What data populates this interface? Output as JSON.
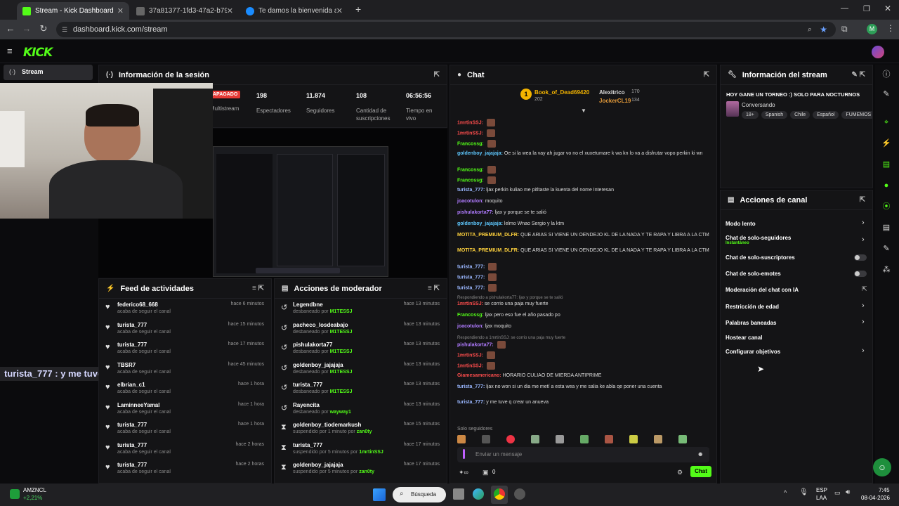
{
  "browser": {
    "tabs": [
      {
        "title": "Stream - Kick Dashboard"
      },
      {
        "title": "37a81377-1fd3-47a2-b79e-557"
      },
      {
        "title": "Te damos la bienvenida a Prime"
      }
    ],
    "url": "dashboard.kick.com/stream",
    "profile_initial": "M"
  },
  "sidebar": {
    "stream_label": "Stream"
  },
  "session": {
    "title": "Información de la sesión",
    "status_badge": "APAGADO",
    "multistream_label": "Multistream",
    "stats": [
      {
        "value": "198",
        "label": "Espectadores"
      },
      {
        "value": "11.874",
        "label": "Seguidores"
      },
      {
        "value": "108",
        "label": "Cantidad de suscripciones"
      },
      {
        "value": "06:56:56",
        "label": "Tiempo en vivo"
      }
    ]
  },
  "overlay_caption": "turista_777 : y me tuve q crear un anueva",
  "activity": {
    "title": "Feed de actividades",
    "rows": [
      {
        "name": "federico68_668",
        "time": "hace 6 minutos",
        "sub": "acaba de seguir el canal"
      },
      {
        "name": "turista_777",
        "time": "hace 15 minutos",
        "sub": "acaba de seguir el canal"
      },
      {
        "name": "turista_777",
        "time": "hace 17 minutos",
        "sub": "acaba de seguir el canal"
      },
      {
        "name": "TBSR7",
        "time": "hace 45 minutos",
        "sub": "acaba de seguir el canal"
      },
      {
        "name": "elbrian_c1",
        "time": "hace 1 hora",
        "sub": "acaba de seguir el canal"
      },
      {
        "name": "LaminneeYamal",
        "time": "hace 1 hora",
        "sub": "acaba de seguir el canal"
      },
      {
        "name": "turista_777",
        "time": "hace 1 hora",
        "sub": "acaba de seguir el canal"
      },
      {
        "name": "turista_777",
        "time": "hace 2 horas",
        "sub": "acaba de seguir el canal"
      },
      {
        "name": "turista_777",
        "time": "hace 2 horas",
        "sub": "acaba de seguir el canal"
      }
    ]
  },
  "moderator": {
    "title": "Acciones de moderador",
    "rows": [
      {
        "name": "Legendbne",
        "time": "hace 13 minutos",
        "sub": "desbaneado por",
        "by": "M1TESSJ"
      },
      {
        "name": "pacheco_losdeabajo",
        "time": "hace 13 minutos",
        "sub": "desbaneado por",
        "by": "M1TESSJ"
      },
      {
        "name": "pishulakorta77",
        "time": "hace 13 minutos",
        "sub": "desbaneado por",
        "by": "M1TESSJ"
      },
      {
        "name": "goldenboy_jajajaja",
        "time": "hace 13 minutos",
        "sub": "desbaneado por",
        "by": "M1TESSJ"
      },
      {
        "name": "turista_777",
        "time": "hace 13 minutos",
        "sub": "desbaneado por",
        "by": "M1TESSJ"
      },
      {
        "name": "Rayencita",
        "time": "hace 13 minutos",
        "sub": "desbaneado por",
        "by": "wayway1"
      },
      {
        "name": "goldenboy_tiodemarkush",
        "time": "hace 15 minutos",
        "sub": "suspendido por 1 minuto por",
        "by": "zan0ty"
      },
      {
        "name": "turista_777",
        "time": "hace 17 minutos",
        "sub": "suspendido por 5 minutos por",
        "by": "1mrtinSSJ"
      },
      {
        "name": "goldenboy_jajajaja",
        "time": "hace 17 minutos",
        "sub": "suspendido por 5 minutos por",
        "by": "zan0ty"
      }
    ]
  },
  "chat": {
    "title": "Chat",
    "top": [
      {
        "rank": "1",
        "name": "Book_of_Dead69420",
        "count": "202"
      },
      {
        "name": "Alexitrico",
        "count": "170"
      },
      {
        "name": "JockerCL19",
        "count": "134"
      }
    ],
    "lines": [
      {
        "user": "1mrtinSSJ:",
        "color": "#ff4d4d",
        "text": ""
      },
      {
        "user": "1mrtinSSJ:",
        "color": "#ff4d4d",
        "text": ""
      },
      {
        "user": "Francossg:",
        "color": "#53fc18",
        "text": ""
      },
      {
        "user": "goldenboy_jajajaja:",
        "color": "#5ec8ff",
        "text": "Oe si la wea la vay ah jugar vo no el xuxetumare k wa kn lo va a disfrutar vopo perkin ki wn"
      },
      {
        "user": "Francossg:",
        "color": "#53fc18",
        "text": ""
      },
      {
        "user": "Francossg:",
        "color": "#53fc18",
        "text": ""
      },
      {
        "user": "turista_777:",
        "color": "#9ab7ff",
        "text": "ljax perkin kuliao me pitltaste la kuenta del nome Interesan"
      },
      {
        "user": "joacotulon:",
        "color": "#b07bff",
        "text": "moquito"
      },
      {
        "user": "pishulakorta77:",
        "color": "#b07bff",
        "text": "ljax y porque se te salió"
      },
      {
        "user": "goldenboy_jajajaja:",
        "color": "#5ec8ff",
        "text": "lelmo Wnao Sergio y la ktm"
      },
      {
        "user": "MOTITA_PREMIUM_DLFR:",
        "color": "#ffd23d",
        "text": "QUE ARIAS SI VIENE UN OENDEJO KL DE LA NADA Y TE RAPA Y LIBRA A LA CTM"
      },
      {
        "user": "MOTITA_PREMIUM_DLFR:",
        "color": "#ffd23d",
        "text": "QUE ARIAS SI VIENE UN OENDEJO KL DE LA NADA Y TE RAPA Y LIBRA A LA CTM"
      },
      {
        "user": "turista_777:",
        "color": "#9ab7ff",
        "text": ""
      },
      {
        "user": "turista_777:",
        "color": "#9ab7ff",
        "text": ""
      },
      {
        "user": "turista_777:",
        "color": "#9ab7ff",
        "text": ""
      },
      {
        "user": "1mrtinSSJ:",
        "color": "#ff4d4d",
        "text": "se corrio una paja muy fuerte",
        "reply": "Respondiendo a pishulakorta77: ljax y porque se te salió"
      },
      {
        "user": "Francossg:",
        "color": "#53fc18",
        "text": "ljax pero eso fue el año pasado po"
      },
      {
        "user": "joacotulon:",
        "color": "#b07bff",
        "text": "ljax moquito"
      },
      {
        "user": "pishulakorta77:",
        "color": "#b07bff",
        "text": "",
        "reply": "Respondiendo a 1mrtinSSJ: se corrio una paja muy fuerte"
      },
      {
        "user": "1mrtinSSJ:",
        "color": "#ff4d4d",
        "text": ""
      },
      {
        "user": "1mrtinSSJ:",
        "color": "#ff4d4d",
        "text": ""
      },
      {
        "user": "Giamesamericano:",
        "color": "#ff4d4d",
        "text": "HORARIO CULIAO DE MIERDA ANTIPRIME"
      },
      {
        "user": "turista_777:",
        "color": "#9ab7ff",
        "text": "ljax no won si un dia me metí a esta wea y me salia ke abla qe poner una cuenta"
      },
      {
        "user": "turista_777:",
        "color": "#9ab7ff",
        "text": "y me tuve q crear un anueva"
      }
    ],
    "followers_only": "Solo seguidores",
    "input_placeholder": "Enviar un mensaje",
    "zero": "0",
    "send_label": "Chat"
  },
  "stream_info": {
    "title": "Información del stream",
    "stream_title": "HOY GANE UN TORNEO :) SOLO PARA NOCTURNOS",
    "category": "Conversando",
    "tags": [
      "18+",
      "Spanish",
      "Chile",
      "Español",
      "FUMEMOS"
    ]
  },
  "channel_actions": {
    "title": "Acciones de canal",
    "items": [
      {
        "label": "Modo lento",
        "control": "chevron"
      },
      {
        "label": "Chat de solo-seguidores",
        "sub": "Instantáneo",
        "control": "chevron"
      },
      {
        "label": "Chat de solo-suscriptores",
        "control": "toggle"
      },
      {
        "label": "Chat de solo-emotes",
        "control": "toggle"
      },
      {
        "label": "Moderación del chat con IA",
        "control": "external"
      },
      {
        "label": "Restricción de edad",
        "control": "chevron"
      },
      {
        "label": "Palabras baneadas",
        "control": "chevron"
      },
      {
        "label": "Hostear canal",
        "control": "none"
      },
      {
        "label": "Configurar objetivos",
        "control": "chevron"
      }
    ]
  },
  "taskbar": {
    "stock_name": "AMZNCL",
    "stock_change": "+2,21%",
    "search_label": "Búsqueda",
    "lang": "ESP",
    "lang2": "LAA",
    "time": "7:45",
    "date": "08-04-2026"
  },
  "colors": {
    "accent": "#53fc18",
    "panel": "#141416",
    "background": "#0b0b0d"
  }
}
